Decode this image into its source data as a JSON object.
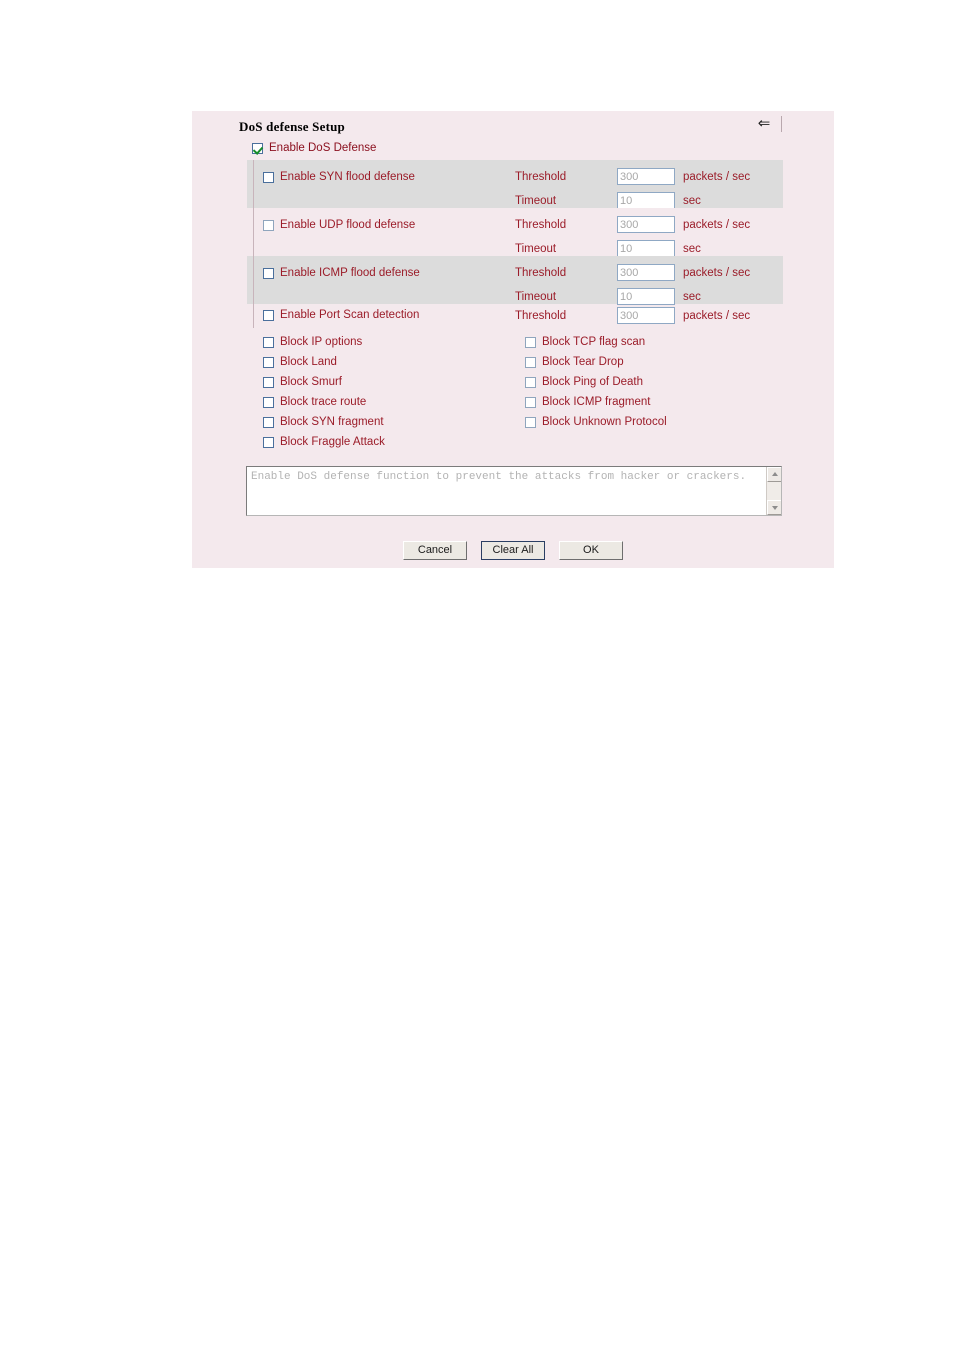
{
  "panel": {
    "title": "DoS defense Setup",
    "back_arrow_icon": "left-arrow-icon",
    "master": {
      "label": "Enable DoS Defense",
      "checked": true
    },
    "flood_rows": [
      {
        "label": "Enable SYN flood defense",
        "checked": false,
        "fields": [
          {
            "label": "Threshold",
            "value": "300",
            "unit": "packets / sec"
          },
          {
            "label": "Timeout",
            "value": "10",
            "unit": "sec"
          }
        ]
      },
      {
        "label": "Enable UDP flood defense",
        "checked": false,
        "fields": [
          {
            "label": "Threshold",
            "value": "300",
            "unit": "packets / sec"
          },
          {
            "label": "Timeout",
            "value": "10",
            "unit": "sec"
          }
        ]
      },
      {
        "label": "Enable ICMP flood defense",
        "checked": false,
        "fields": [
          {
            "label": "Threshold",
            "value": "300",
            "unit": "packets / sec"
          },
          {
            "label": "Timeout",
            "value": "10",
            "unit": "sec"
          }
        ]
      }
    ],
    "portscan": {
      "label": "Enable Port Scan detection",
      "checked": false,
      "field": {
        "label": "Threshold",
        "value": "300",
        "unit": "packets / sec"
      }
    },
    "block_options": {
      "column_left": [
        {
          "label": "Block IP options",
          "checked": false
        },
        {
          "label": "Block Land",
          "checked": false
        },
        {
          "label": "Block Smurf",
          "checked": false
        },
        {
          "label": "Block trace route",
          "checked": false
        },
        {
          "label": "Block SYN fragment",
          "checked": false
        },
        {
          "label": "Block Fraggle Attack",
          "checked": false
        }
      ],
      "column_right": [
        {
          "label": "Block TCP flag scan",
          "checked": false
        },
        {
          "label": "Block Tear Drop",
          "checked": false
        },
        {
          "label": "Block Ping of Death",
          "checked": false
        },
        {
          "label": "Block ICMP fragment",
          "checked": false
        },
        {
          "label": "Block Unknown Protocol",
          "checked": false
        }
      ]
    },
    "description": "Enable DoS defense function to prevent the attacks from hacker or crackers.",
    "buttons": [
      {
        "label": "Cancel",
        "default": false
      },
      {
        "label": "Clear All",
        "default": true
      },
      {
        "label": "OK",
        "default": false
      }
    ],
    "colors": {
      "panel_background": "#f4e9ed",
      "stripe_gray": "#dcdcdc",
      "label_red": "#9b1c29",
      "title_black": "#000000",
      "input_text_gray": "#a8a8a8",
      "check_green": "#168c2a"
    }
  }
}
